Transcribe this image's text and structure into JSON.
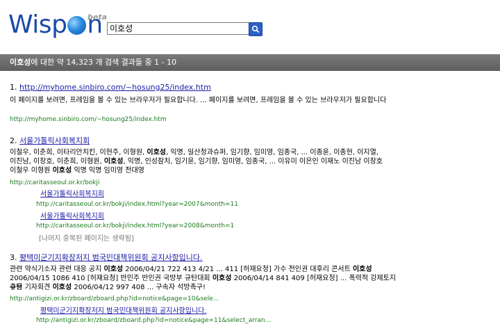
{
  "logo": {
    "pre": "Wisp",
    "post": "n",
    "beta": "beta"
  },
  "search": {
    "value": "이호성"
  },
  "summary": {
    "query": "이호성",
    "text": "에 대한 약 14,323 개 검색 결과들 중 1 - 10"
  },
  "results": [
    {
      "num": "1.",
      "title": "http://myhome.sinbiro.com/~hosung25/index.htm",
      "snippet": "이 페이지를 보려면, 프레임을 볼 수 있는 브라우저가 필요합니다. ... 페이지를 보려면, 프레임을 볼 수 있는 브라우저가 필요합니다",
      "url": "http://myhome.sinbiro.com/~hosung25/index.htm"
    },
    {
      "num": "2.",
      "title": "서울가톨릭사회복지회",
      "snippet_lines": [
        "이철우, 이춘희, 이타리안치킨, 이현주, 이형원, 이호성, 익명, 일산청과슈퍼, 임기향, 임미영, 임종국, ... 이종윤, 이종현, 이지열,",
        "이진남, 이창호, 이춘희, 이형원, 이호성, 익명, 인성참치, 임기윤, 임기향, 임미영, 임종국, ... 이유미 이은인 이재노 이진남 이창호",
        "이철우 이형원 이호성 익명 익명 임미영 전대영"
      ],
      "url": "http://caritasseoul.or.kr/bokji",
      "subs": [
        {
          "title": "서울가톨릭사회복지회",
          "url": "http://caritasseoul.or.kr/bokji/index.html?year=2007&month=11"
        },
        {
          "title": "서울가톨릭사회복지회",
          "url": "http://caritasseoul.or.kr/bokji/index.html?year=2008&month=1"
        }
      ],
      "more": "[나머지 중복된 페이지는 생략됨]"
    },
    {
      "num": "3.",
      "title": "평택미군기지확장저지 범국민대책위원회 공지사항입니다.",
      "snippet_lines": [
        "관련 약식기소자 관련 대응 공지 이호성 2006/04/21 722 413 4/21 ... 411 [허재요청] 가수 전인권 대후리 콘서트 이호성",
        "2006/04/15 1086 410 [허재요청] 반민주 반인권 국방부 규탄대회 이호성 2006/04/14 841 409 [허재요청] ... 폭력적 강제토지수용",
        "규탄 기자회견 이호성 2006/04/12 997 408 ... 구속자 석방촉구!"
      ],
      "url": "http://antigizi.or.kr/zboard/zboard.php?id=notice&page=10&sele...",
      "subs": [
        {
          "title": "평택미군기지확장저지 범국민대책위원회 공지사항입니다.",
          "url": "http://antigizi.or.kr/zboard/zboard.php?id=notice&page=11&select_arran..."
        }
      ]
    }
  ],
  "colors": {
    "link": "#1a1aa6",
    "url": "#1a7a1a",
    "logo": "#1a4aa8",
    "bar": "#6a6a6a"
  }
}
